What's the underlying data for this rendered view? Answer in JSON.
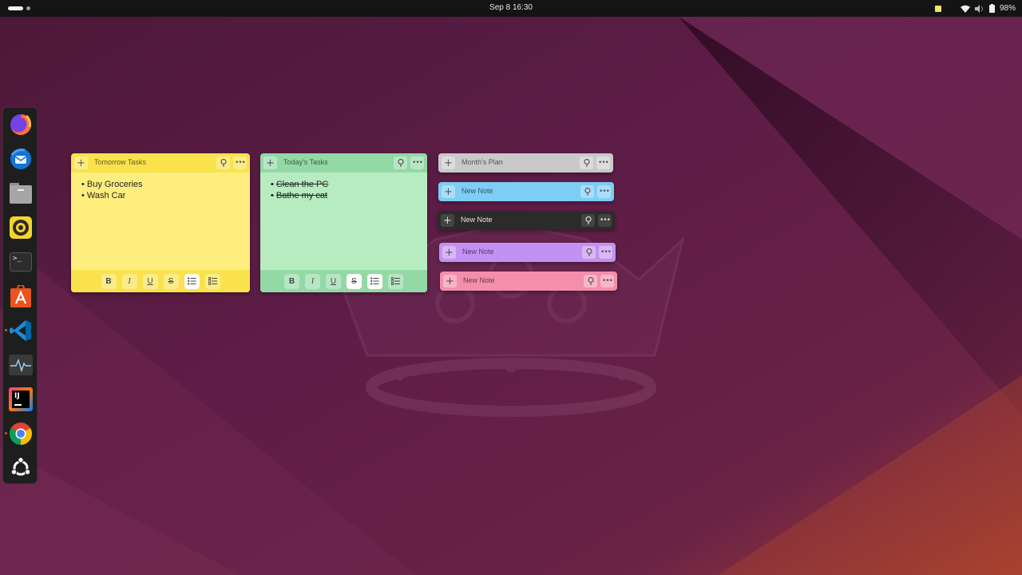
{
  "topbar": {
    "datetime": "Sep 8  16:30",
    "battery": "98%",
    "icons": [
      "sticky-notes-indicator-icon",
      "wifi-icon",
      "volume-icon",
      "battery-icon"
    ]
  },
  "dock": {
    "apps": [
      {
        "name": "Firefox",
        "icon": "firefox-icon"
      },
      {
        "name": "Thunderbird",
        "icon": "thunderbird-icon"
      },
      {
        "name": "Files",
        "icon": "files-icon"
      },
      {
        "name": "Rhythmbox",
        "icon": "rhythmbox-icon"
      },
      {
        "name": "Terminal",
        "icon": "terminal-icon"
      },
      {
        "name": "App Center",
        "icon": "app-center-icon"
      },
      {
        "name": "Visual Studio Code",
        "icon": "vscode-icon"
      },
      {
        "name": "System Monitor",
        "icon": "system-monitor-icon"
      },
      {
        "name": "IntelliJ IDEA",
        "icon": "intellij-icon"
      },
      {
        "name": "Google Chrome",
        "icon": "chrome-icon"
      },
      {
        "name": "Show Apps",
        "icon": "ubuntu-icon"
      }
    ],
    "terminal_glyph": ">_",
    "intellij_glyph": "IJ"
  },
  "notes": {
    "tomorrow": {
      "title": "Tomorrow Tasks",
      "items": [
        "Buy Groceries",
        "Wash Car"
      ],
      "color_header": "#f9e24c",
      "color_body": "#fdee7e"
    },
    "today": {
      "title": "Today's Tasks",
      "items": [
        "Clean the PC",
        "Bathe my cat"
      ],
      "items_struck": true,
      "color_header": "#93d9a6",
      "color_body": "#b7ecc1"
    },
    "collapsed": [
      {
        "title": "Month's Plan",
        "color": "#c9c9c9"
      },
      {
        "title": "New Note",
        "color": "#7dcdf5"
      },
      {
        "title": "New Note",
        "color": "#2b2b2b"
      },
      {
        "title": "New Note",
        "color": "#c391f2"
      },
      {
        "title": "New Note",
        "color": "#f38fab"
      }
    ],
    "toolbar": {
      "bold": "B",
      "italic": "I",
      "underline": "U",
      "strike": "S"
    }
  }
}
